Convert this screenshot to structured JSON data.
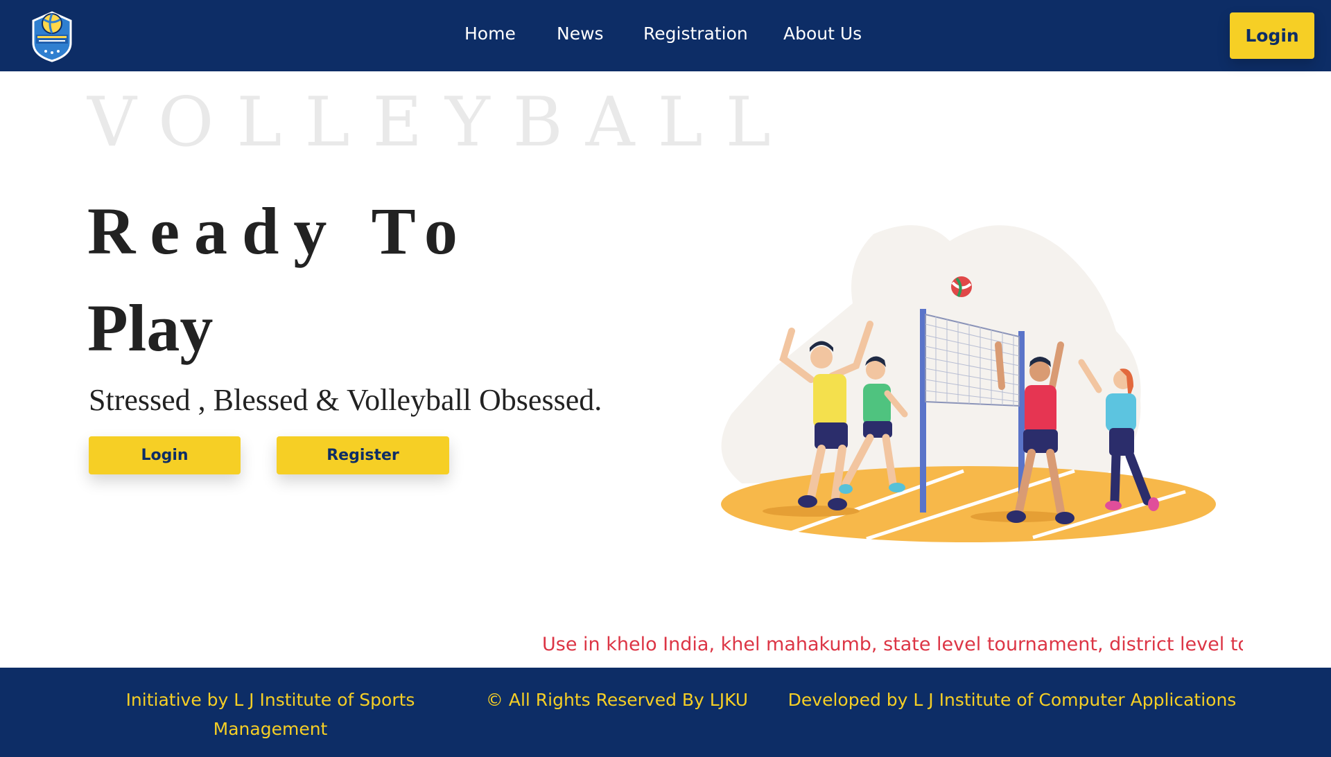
{
  "nav": {
    "home": "Home",
    "news": "News",
    "registration": "Registration",
    "about": "About Us",
    "login": "Login"
  },
  "hero": {
    "watermark": "VOLLEYBALL",
    "line1": "Ready To",
    "line2": "Play",
    "tagline": "Stressed , Blessed & Volleyball Obsessed.",
    "login_label": "Login",
    "register_label": "Register"
  },
  "ticker": {
    "text": "Use in khelo India, khel mahakumb, state level tournament, district level to"
  },
  "footer": {
    "initiative": "Initiative by L J Institute of Sports Management",
    "rights": "© All Rights Reserved By LJKU",
    "developed": "Developed by L J Institute of Computer Applications"
  },
  "colors": {
    "navy": "#0d2d66",
    "yellow": "#f6cf25",
    "ticker_red": "#dc3545",
    "court_orange": "#f7b84a"
  },
  "icons": {
    "logo": "volleyball-shield-logo",
    "illustration": "volleyball-players-illustration"
  }
}
